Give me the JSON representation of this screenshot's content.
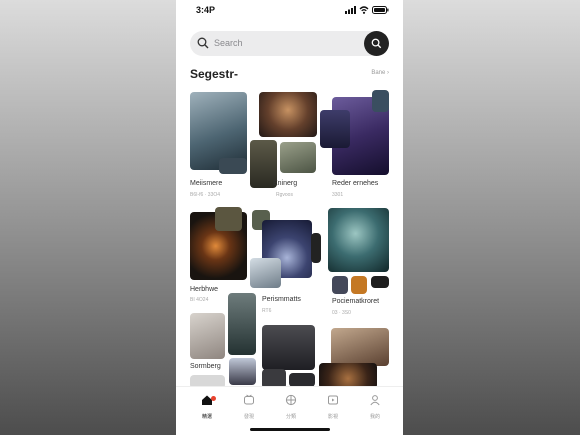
{
  "status": {
    "time": "3:4P"
  },
  "search": {
    "placeholder": "Search"
  },
  "section": {
    "title": "Segestr-",
    "see_all": "Bane"
  },
  "items": [
    {
      "title": "Meiismere",
      "meta": "B6I-f6 · 33O4"
    },
    {
      "title": "Eninerg",
      "meta": "Rgvoos"
    },
    {
      "title": "Reder ernehes",
      "meta": "3301"
    },
    {
      "title": "Herbhwe",
      "meta": "BI 4O24"
    },
    {
      "title": "Perismmatts",
      "meta": "RT6"
    },
    {
      "title": "Pociematkroret",
      "meta": "03 · 3S0"
    },
    {
      "title": "Sormberg",
      "meta": ""
    }
  ],
  "tabs": [
    {
      "label": "精選",
      "icon": "home-icon",
      "active": true
    },
    {
      "label": "發現",
      "icon": "discover-icon",
      "active": false
    },
    {
      "label": "分類",
      "icon": "globe-icon",
      "active": false
    },
    {
      "label": "影視",
      "icon": "play-icon",
      "active": false
    },
    {
      "label": "我的",
      "icon": "user-icon",
      "active": false
    }
  ],
  "colors": {
    "accent": "#e8432f",
    "dark": "#222222"
  }
}
